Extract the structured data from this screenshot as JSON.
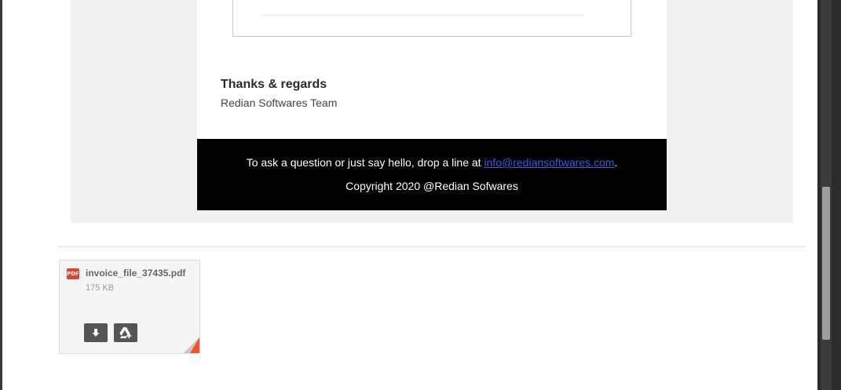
{
  "email": {
    "signoff": "Thanks & regards",
    "team": "Redian Softwares Team",
    "footer": {
      "text_prefix": "To ask a question or just say hello, drop a line at ",
      "email_link": "info@rediansoftwares.com",
      "text_suffix": ".",
      "copyright": "Copyright 2020 @Redian Sofwares"
    }
  },
  "attachment": {
    "file_icon": "pdf-icon",
    "file_icon_label": "PDF",
    "file_name": "invoice_file_37435.pdf",
    "file_size": "175 KB",
    "actions": {
      "download_icon": "download-icon",
      "drive_icon": "google-drive-icon"
    }
  },
  "colors": {
    "footer_bg": "#000000",
    "link": "#3b5bdb",
    "pdf_red": "#e0432f",
    "corner_accent": "#f2552c"
  }
}
